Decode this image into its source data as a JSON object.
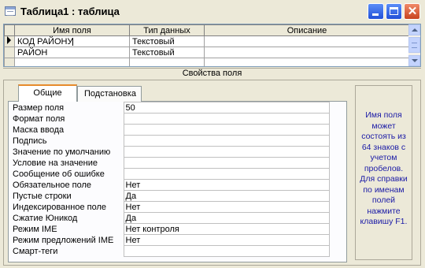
{
  "window": {
    "title": "Таблица1 : таблица"
  },
  "grid": {
    "headers": [
      "Имя поля",
      "Тип данных",
      "Описание"
    ],
    "rows": [
      {
        "name": "КОД РАЙОНУ",
        "type": "Текстовый",
        "description": ""
      },
      {
        "name": "РАЙОН",
        "type": "Текстовый",
        "description": ""
      },
      {
        "name": "",
        "type": "",
        "description": ""
      }
    ]
  },
  "properties": {
    "label": "Свойства поля",
    "tabs": [
      "Общие",
      "Подстановка"
    ],
    "active_tab": "Общие",
    "items": [
      {
        "label": "Размер поля",
        "value": "50"
      },
      {
        "label": "Формат поля",
        "value": ""
      },
      {
        "label": "Маска ввода",
        "value": ""
      },
      {
        "label": "Подпись",
        "value": ""
      },
      {
        "label": "Значение по умолчанию",
        "value": ""
      },
      {
        "label": "Условие на значение",
        "value": ""
      },
      {
        "label": "Сообщение об ошибке",
        "value": ""
      },
      {
        "label": "Обязательное поле",
        "value": "Нет"
      },
      {
        "label": "Пустые строки",
        "value": "Да"
      },
      {
        "label": "Индексированное поле",
        "value": "Нет"
      },
      {
        "label": "Сжатие Юникод",
        "value": "Да"
      },
      {
        "label": "Режим IME",
        "value": "Нет контроля"
      },
      {
        "label": "Режим предложений IME",
        "value": "Нет"
      },
      {
        "label": "Смарт-теги",
        "value": ""
      }
    ],
    "help_text": "Имя поля может состоять из 64 знаков с учетом пробелов. Для справки по именам полей нажмите клавишу F1."
  },
  "colors": {
    "help_text": "#1a1aa6",
    "tab_accent": "#e68b2c",
    "close_button": "#c8431e"
  }
}
